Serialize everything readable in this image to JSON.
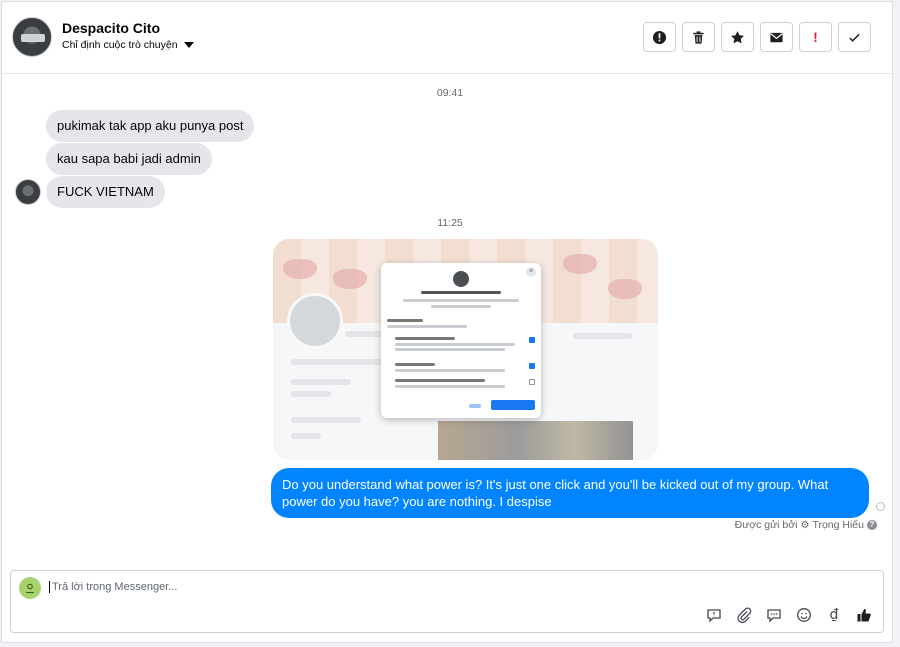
{
  "header": {
    "name": "Despacito Cito",
    "subtitle": "Chỉ định cuộc trò chuyện"
  },
  "toolbar": {
    "buttons": [
      {
        "icon": "alert-circle-icon",
        "label": "!"
      },
      {
        "icon": "trash-icon"
      },
      {
        "icon": "star-icon"
      },
      {
        "icon": "envelope-icon"
      },
      {
        "icon": "exclamation-icon",
        "label": "!"
      },
      {
        "icon": "check-icon"
      }
    ]
  },
  "conversation": {
    "time1": "09:41",
    "incoming": [
      "pukimak tak app aku punya post",
      "kau sapa babi jadi admin",
      "FUCK VIETNAM"
    ],
    "time2": "11:25",
    "outgoing": "Do you understand what power is? It's just one click and you'll be kicked out of my group. What power do you have? you are nothing. I despise",
    "sent_by_prefix": "Được gửi bởi",
    "sent_by_name": "Trọng Hiếu"
  },
  "composer": {
    "placeholder": "Trả lời trong Messenger..."
  },
  "colors": {
    "accent": "#0084ff",
    "incoming_bubble": "#e4e6eb"
  }
}
